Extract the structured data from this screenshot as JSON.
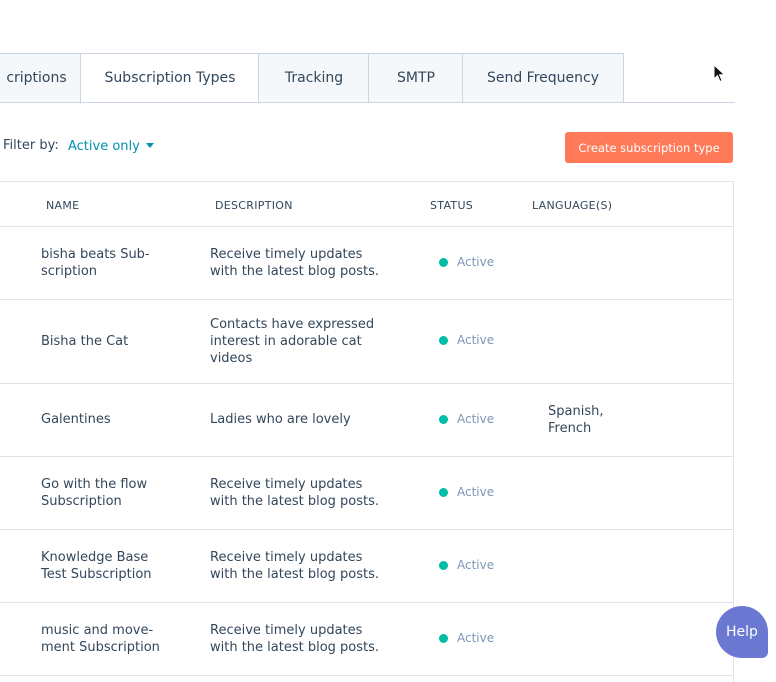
{
  "tabs": [
    {
      "label": "criptions",
      "active": false
    },
    {
      "label": "Subscription Types",
      "active": true
    },
    {
      "label": "Tracking",
      "active": false
    },
    {
      "label": "SMTP",
      "active": false
    },
    {
      "label": "Send Frequency",
      "active": false
    }
  ],
  "filter": {
    "label": "Filter by:",
    "value": "Active only"
  },
  "create_button": "Create subscription type",
  "table": {
    "headers": {
      "name": "NAME",
      "description": "DESCRIPTION",
      "status": "STATUS",
      "languages": "LANGUAGE(S)"
    },
    "rows": [
      {
        "name": "bisha beats Sub-\nscription",
        "description": "Receive timely updates\nwith the latest blog posts.",
        "status": "Active",
        "languages": ""
      },
      {
        "name": "Bisha the Cat",
        "description": "Contacts have expressed\ninterest in adorable cat\nvideos",
        "status": "Active",
        "languages": ""
      },
      {
        "name": "Galentines",
        "description": "Ladies who are lovely",
        "status": "Active",
        "languages": "Spanish,\nFrench"
      },
      {
        "name": "Go with the flow\nSubscription",
        "description": "Receive timely updates\nwith the latest blog posts.",
        "status": "Active",
        "languages": ""
      },
      {
        "name": "Knowledge Base\nTest Subscription",
        "description": "Receive timely updates\nwith the latest blog posts.",
        "status": "Active",
        "languages": ""
      },
      {
        "name": "music and move-\nment Subscription",
        "description": "Receive timely updates\nwith the latest blog posts.",
        "status": "Active",
        "languages": ""
      }
    ]
  },
  "colors": {
    "accent": "#ff7a59",
    "link": "#0091ae",
    "status_active": "#00bda5",
    "help": "#6a78d1"
  },
  "help_button": "Help",
  "cursor_icon": "mouse-pointer-icon"
}
